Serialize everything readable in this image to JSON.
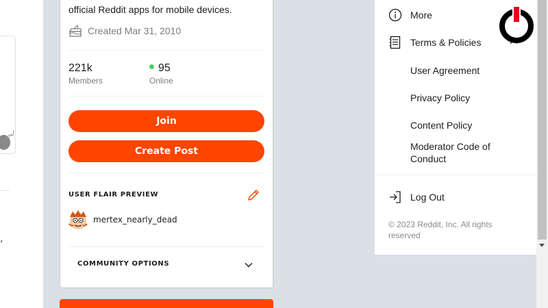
{
  "community": {
    "description_fragment": "official Reddit apps for mobile devices.",
    "created": "Created Mar 31, 2010",
    "members_value": "221k",
    "members_label": "Members",
    "online_value": "95",
    "online_label": "Online",
    "join_label": "Join",
    "create_post_label": "Create Post",
    "flair_preview_title": "USER FLAIR PREVIEW",
    "flair_username": "mertex_nearly_dead",
    "community_options_label": "COMMUNITY OPTIONS"
  },
  "left": {
    "comma_fragment": ","
  },
  "menu": {
    "more_label": "More",
    "terms_label": "Terms & Policies",
    "sub_items": [
      "User Agreement",
      "Privacy Policy",
      "Content Policy",
      "Moderator Code of Conduct"
    ],
    "logout_label": "Log Out",
    "copyright": "© 2023 Reddit, Inc. All rights reserved"
  },
  "colors": {
    "accent": "#ff4500",
    "online": "#46d160",
    "page_bg": "#dae0e6"
  },
  "icons": [
    "cake-icon",
    "pencil-icon",
    "chevron-down-icon",
    "info-icon",
    "document-icon",
    "chevron-up-icon",
    "logout-icon",
    "power-logo"
  ]
}
